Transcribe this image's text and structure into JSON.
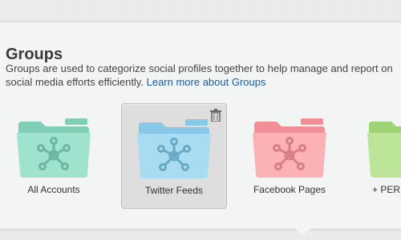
{
  "groups": {
    "title": "Groups",
    "description": "Groups are used to categorize social profiles together to help manage and report on social media efforts efficiently.",
    "learn_more_link": "Learn more about Groups",
    "items": [
      {
        "label": "All Accounts",
        "color": "#9fe3cf",
        "tab_color": "#7fcfb8",
        "selected": false
      },
      {
        "label": "Twitter Feeds",
        "color": "#a9dcf0",
        "tab_color": "#86c8e5",
        "selected": true
      },
      {
        "label": "Facebook Pages",
        "color": "#fbb1b5",
        "tab_color": "#f28f96",
        "selected": false
      },
      {
        "label": "+ PER",
        "color": "#bce59a",
        "tab_color": "#9fd476",
        "selected": false
      }
    ]
  },
  "icons": {
    "folder": "folder-icon",
    "network": "network-icon",
    "trash": "trash-icon"
  }
}
